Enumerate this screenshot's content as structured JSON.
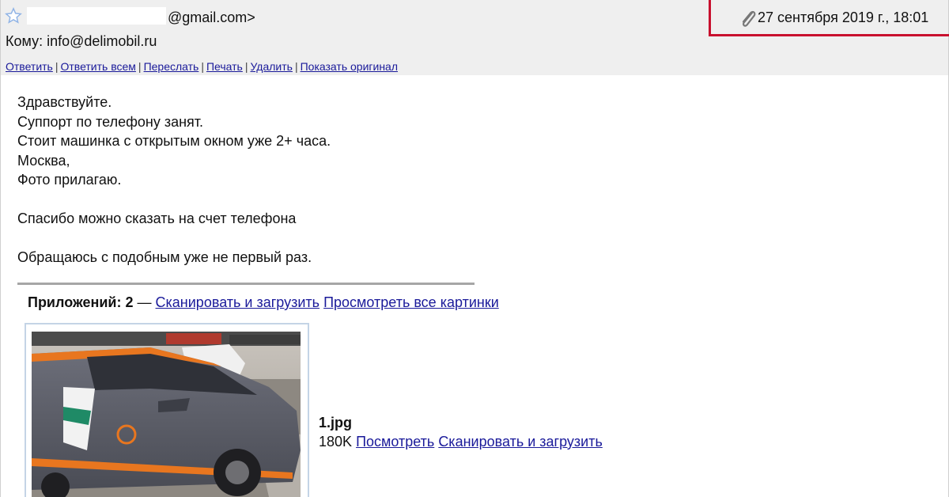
{
  "header": {
    "from_suffix": "@gmail.com>",
    "to_label": "Кому:",
    "to_address": "info@delimobil.ru",
    "date": "27 сентября 2019 г., 18:01"
  },
  "actions": [
    {
      "label": "Ответить"
    },
    {
      "label": "Ответить всем"
    },
    {
      "label": "Переслать"
    },
    {
      "label": "Печать"
    },
    {
      "label": "Удалить"
    },
    {
      "label": "Показать оригинал"
    }
  ],
  "message": {
    "lines": [
      "Здравствуйте.",
      "Суппорт по телефону занят.",
      "Стоит машинка с открытым окном уже 2+ часа.",
      "Москва,",
      "Фото прилагаю.",
      "",
      "Спасибо можно сказать на счет телефона",
      "",
      "Обращаюсь с подобным уже не первый раз."
    ]
  },
  "attachments": {
    "label": "Приложений: 2",
    "dash": "—",
    "scan_link": "Сканировать и загрузить",
    "view_all_link": "Просмотреть все картинки"
  },
  "file": {
    "name": "1.jpg",
    "size": "180K",
    "view_link": "Посмотреть",
    "scan_link": "Сканировать и загрузить"
  },
  "colors": {
    "highlight_box": "#c8102e",
    "link": "#1a1a9a",
    "header_bg": "#efefef"
  }
}
